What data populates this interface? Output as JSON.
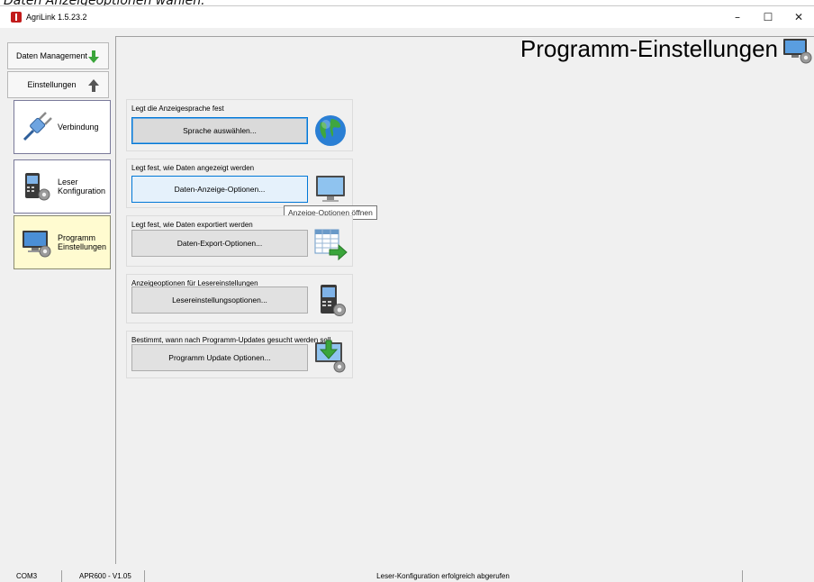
{
  "doc_caption": "Daten Anzeigeoptionen wählen.",
  "window": {
    "title": "AgriLink 1.5.23.2",
    "controls": {
      "minimize": "–",
      "maximize": "☐",
      "close": "✕"
    }
  },
  "sidebar": {
    "top_tabs": [
      {
        "label": "Daten Management",
        "arrow": "arrow-down-icon",
        "color": "#3aa53a"
      },
      {
        "label": "Einstellungen",
        "arrow": "arrow-up-icon",
        "color": "#555555"
      }
    ],
    "items": [
      {
        "label": "Verbindung",
        "icon": "plug-icon",
        "active": false
      },
      {
        "label": "Leser Konfiguration",
        "icon": "reader-config-icon",
        "active": false
      },
      {
        "label": "Programm Einstellungen",
        "icon": "monitor-settings-icon",
        "active": true
      }
    ]
  },
  "main": {
    "title": "Programm-Einstellungen",
    "groups": [
      {
        "legend": "Legt die Anzeigesprache fest",
        "button": "Sprache auswählen...",
        "icon": "globe-icon"
      },
      {
        "legend": "Legt fest, wie Daten angezeigt werden",
        "button": "Daten-Anzeige-Optionen...",
        "icon": "monitor-icon"
      },
      {
        "legend": "Legt fest, wie Daten exportiert werden",
        "button": "Daten-Export-Optionen...",
        "icon": "table-export-icon"
      },
      {
        "legend": "Anzeigeoptionen für Lesereinstellungen",
        "button": "Lesereinstellungsoptionen...",
        "icon": "reader-settings-icon"
      },
      {
        "legend": "Bestimmt, wann nach Programm-Updates gesucht werden soll.",
        "button": "Programm Update Optionen...",
        "icon": "update-download-icon"
      }
    ],
    "tooltip": "Anzeige-Optionen öffnen"
  },
  "statusbar": {
    "port": "COM3",
    "device": "APR600 - V1.05",
    "message": "Leser-Konfiguration erfolgreich abgerufen"
  },
  "colors": {
    "accent": "#0078d7",
    "active_item_bg": "#fffbd0",
    "arrow_green": "#3aa53a"
  }
}
